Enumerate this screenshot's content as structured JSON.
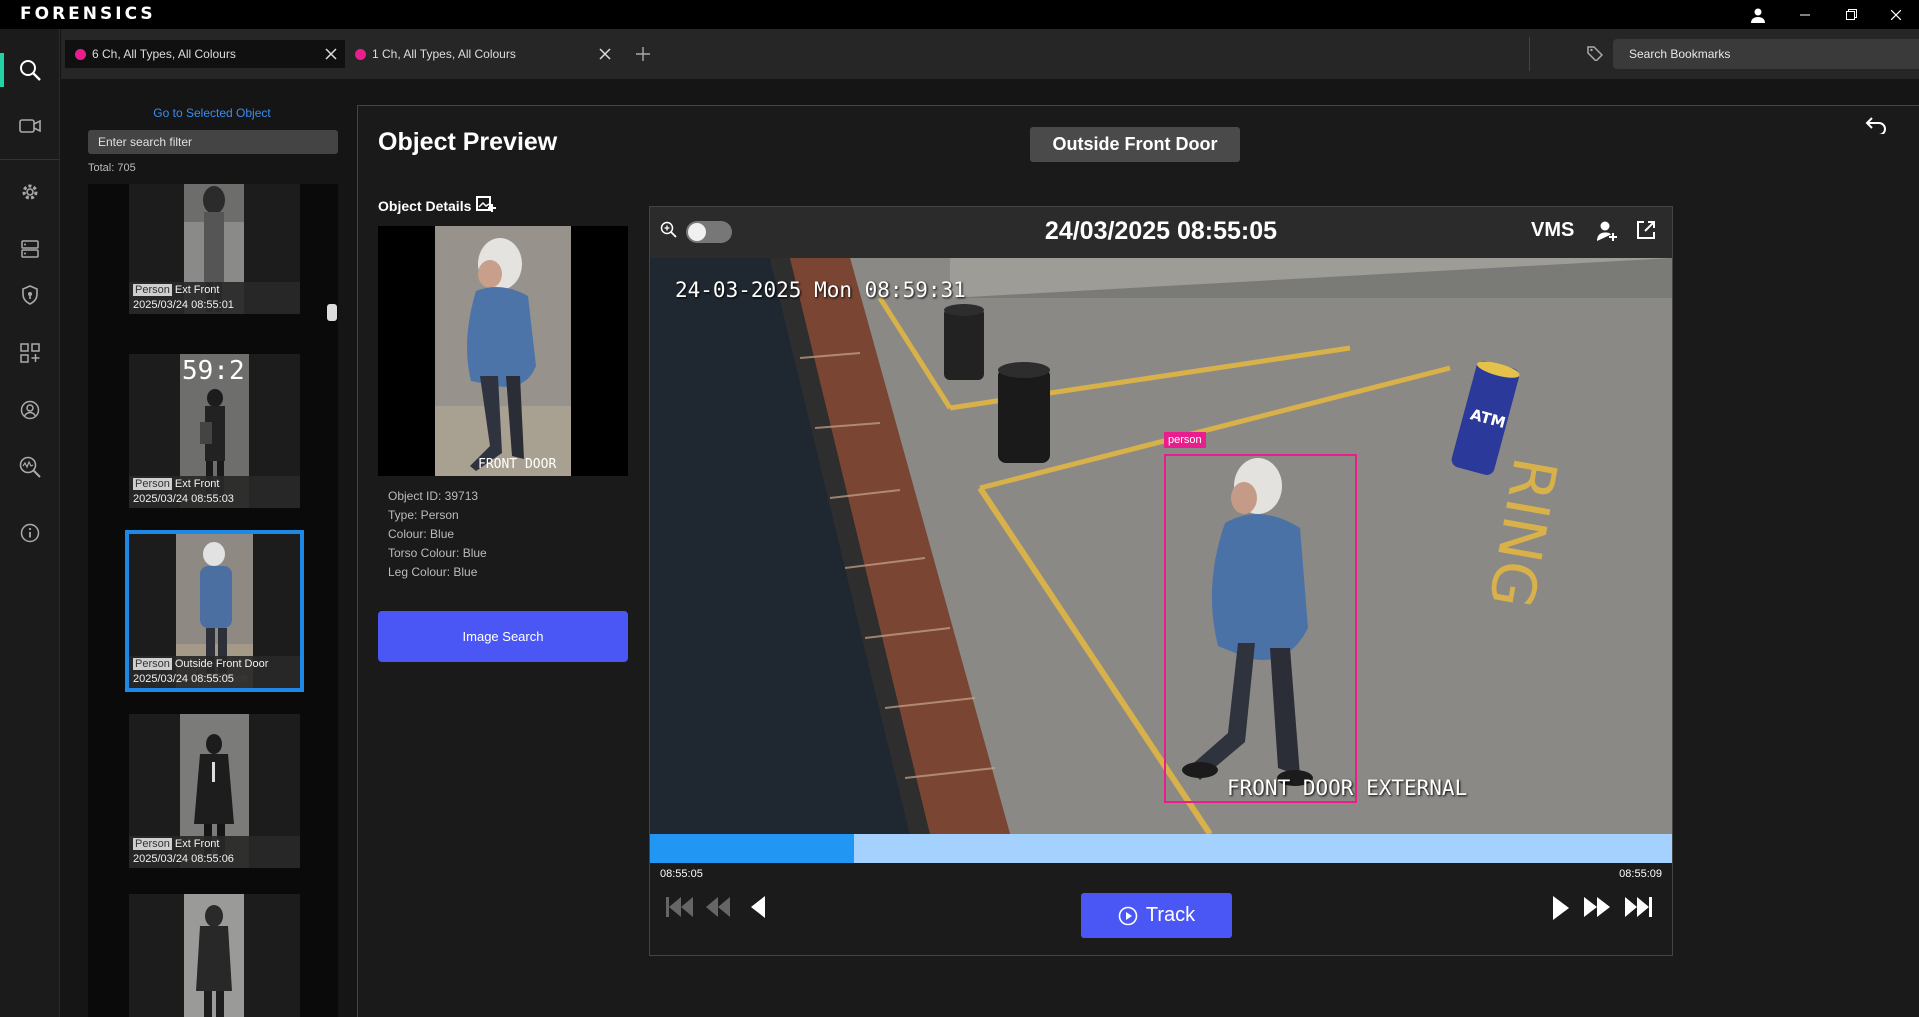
{
  "app": {
    "logo": "FORENSICS"
  },
  "sidebar": {
    "items": [
      {
        "id": "search",
        "icon": "search-icon",
        "active": true
      },
      {
        "id": "video",
        "icon": "video-camera-icon"
      },
      {
        "id": "settings",
        "icon": "gear-icon"
      },
      {
        "id": "servers",
        "icon": "server-icon"
      },
      {
        "id": "security",
        "icon": "shield-icon"
      },
      {
        "id": "widgets",
        "icon": "dashboard-add-icon"
      },
      {
        "id": "account",
        "icon": "user-circle-icon"
      },
      {
        "id": "analytics",
        "icon": "zoom-analytics-icon"
      },
      {
        "id": "info",
        "icon": "info-icon"
      }
    ]
  },
  "tabs": [
    {
      "label": "6 Ch, All Types, All Colours",
      "color": "#e91e8c",
      "active": true
    },
    {
      "label": "1 Ch, All Types, All Colours",
      "color": "#e91e8c",
      "active": false
    }
  ],
  "bookmarks": {
    "placeholder": "Search Bookmarks"
  },
  "results": {
    "goto_label": "Go to Selected Object",
    "filter_placeholder": "Enter search filter",
    "total": "Total: 705",
    "cards": [
      {
        "type": "Person",
        "camera": "Ext Front",
        "time": "2025/03/24 08:55:01"
      },
      {
        "type": "Person",
        "camera": "Ext Front",
        "time": "2025/03/24 08:55:03"
      },
      {
        "type": "Person",
        "camera": "Outside Front Door",
        "time": "2025/03/24 08:55:05",
        "selected": true
      },
      {
        "type": "Person",
        "camera": "Ext Front",
        "time": "2025/03/24 08:55:06"
      },
      {
        "type": "",
        "camera": "",
        "time": ""
      }
    ]
  },
  "preview": {
    "title": "Object Preview",
    "camera_name": "Outside Front Door",
    "details_title": "Object Details",
    "crop_overlay": "FRONT DOOR",
    "details": [
      "Object ID: 39713",
      "Type: Person",
      "Colour: Blue",
      "Torso Colour: Blue",
      "Leg Colour: Blue"
    ],
    "image_search_label": "Image Search"
  },
  "player": {
    "timestamp": "24/03/2025 08:55:05",
    "vms_label": "VMS",
    "osd_top": "24-03-2025 Mon 08:59:31",
    "osd_bottom": "FRONT DOOR EXTERNAL",
    "bbox_label": "person",
    "timeline_start": "08:55:05",
    "timeline_end": "08:55:09",
    "timeline_progress": 0.2,
    "track_label": "Track",
    "sign_text": "ATM"
  }
}
